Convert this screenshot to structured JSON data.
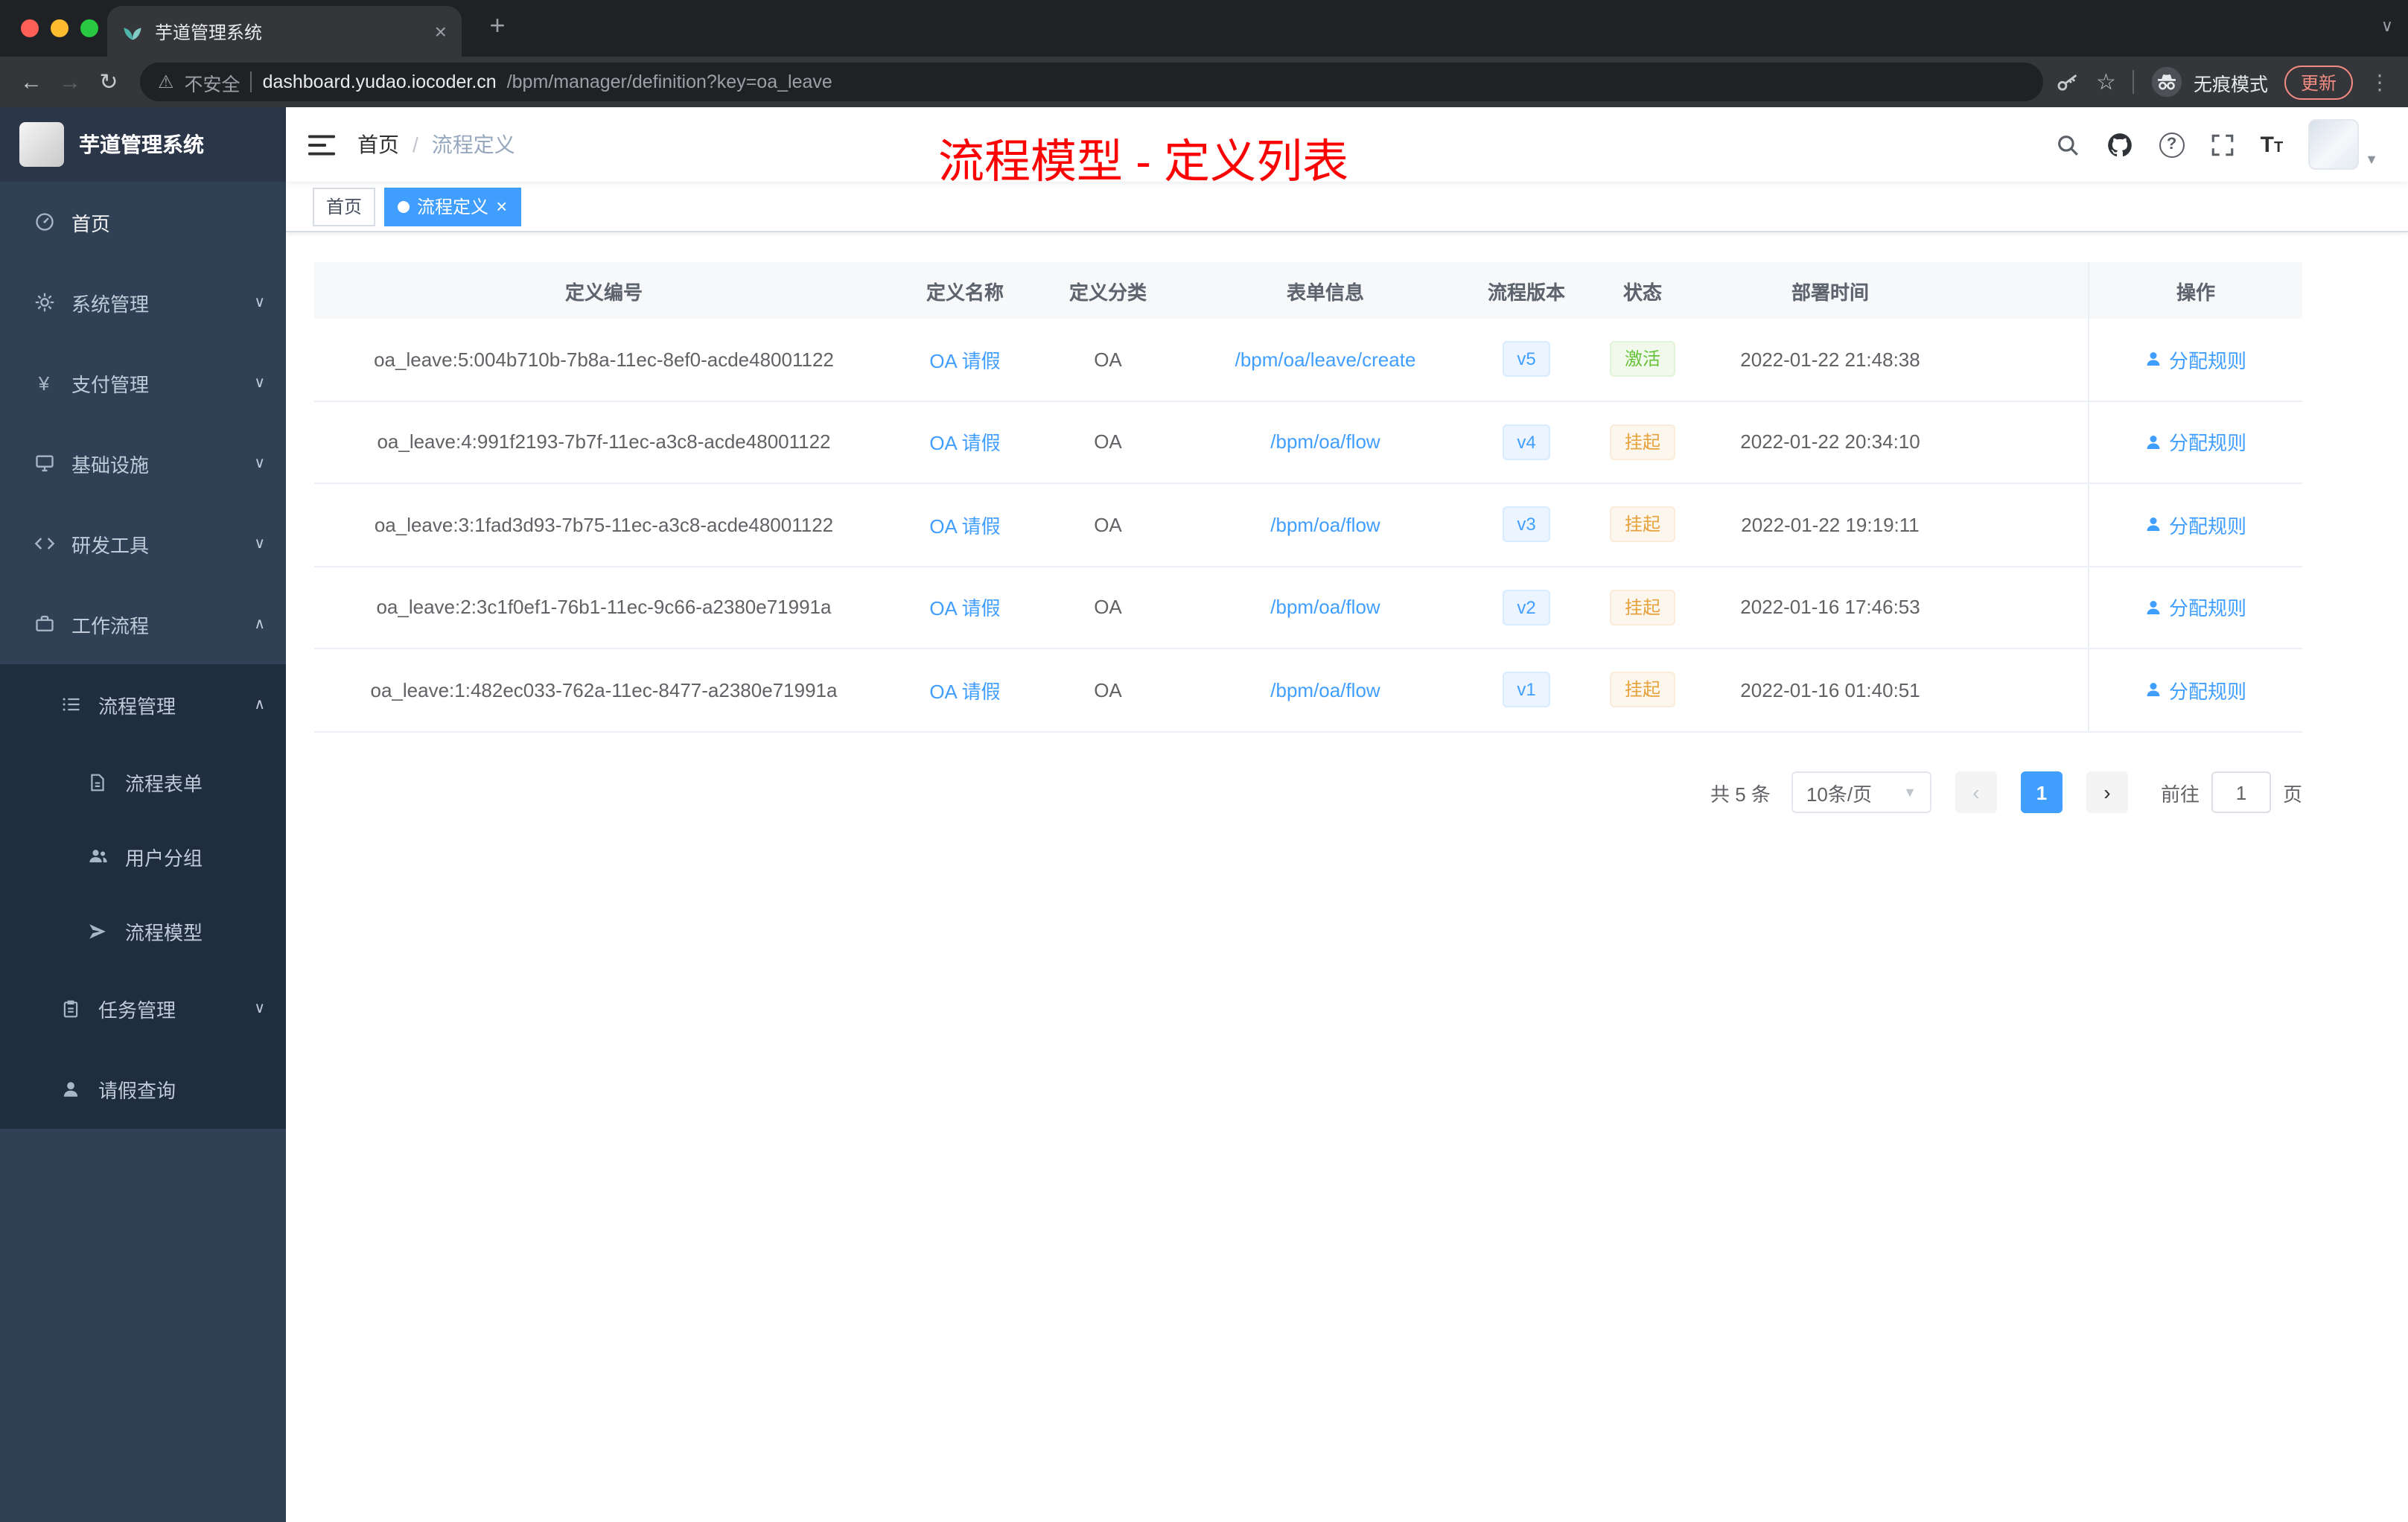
{
  "browser": {
    "tab_title": "芋道管理系统",
    "security_label": "不安全",
    "url_domain": "dashboard.yudao.iocoder.cn",
    "url_path": "/bpm/manager/definition?key=oa_leave",
    "incognito_label": "无痕模式",
    "update_label": "更新"
  },
  "sidebar": {
    "logo_title": "芋道管理系统",
    "items": [
      {
        "label": "首页"
      },
      {
        "label": "系统管理"
      },
      {
        "label": "支付管理"
      },
      {
        "label": "基础设施"
      },
      {
        "label": "研发工具"
      },
      {
        "label": "工作流程"
      },
      {
        "label": "流程管理"
      },
      {
        "label": "流程表单"
      },
      {
        "label": "用户分组"
      },
      {
        "label": "流程模型"
      },
      {
        "label": "任务管理"
      },
      {
        "label": "请假查询"
      }
    ]
  },
  "header": {
    "breadcrumb": {
      "home": "首页",
      "sep": "/",
      "current": "流程定义"
    },
    "annotation": "流程模型 - 定义列表"
  },
  "tags": {
    "home": "首页",
    "active": "流程定义"
  },
  "table": {
    "columns": [
      "定义编号",
      "定义名称",
      "定义分类",
      "表单信息",
      "流程版本",
      "状态",
      "部署时间",
      "操作"
    ],
    "rows": [
      {
        "id": "oa_leave:5:004b710b-7b8a-11ec-8ef0-acde48001122",
        "name": "OA 请假",
        "category": "OA",
        "form": "/bpm/oa/leave/create",
        "version": "v5",
        "status": "激活",
        "status_type": "success",
        "time": "2022-01-22 21:48:38",
        "action": "分配规则"
      },
      {
        "id": "oa_leave:4:991f2193-7b7f-11ec-a3c8-acde48001122",
        "name": "OA 请假",
        "category": "OA",
        "form": "/bpm/oa/flow",
        "version": "v4",
        "status": "挂起",
        "status_type": "warning",
        "time": "2022-01-22 20:34:10",
        "action": "分配规则"
      },
      {
        "id": "oa_leave:3:1fad3d93-7b75-11ec-a3c8-acde48001122",
        "name": "OA 请假",
        "category": "OA",
        "form": "/bpm/oa/flow",
        "version": "v3",
        "status": "挂起",
        "status_type": "warning",
        "time": "2022-01-22 19:19:11",
        "action": "分配规则"
      },
      {
        "id": "oa_leave:2:3c1f0ef1-76b1-11ec-9c66-a2380e71991a",
        "name": "OA 请假",
        "category": "OA",
        "form": "/bpm/oa/flow",
        "version": "v2",
        "status": "挂起",
        "status_type": "warning",
        "time": "2022-01-16 17:46:53",
        "action": "分配规则"
      },
      {
        "id": "oa_leave:1:482ec033-762a-11ec-8477-a2380e71991a",
        "name": "OA 请假",
        "category": "OA",
        "form": "/bpm/oa/flow",
        "version": "v1",
        "status": "挂起",
        "status_type": "warning",
        "time": "2022-01-16 01:40:51",
        "action": "分配规则"
      }
    ]
  },
  "pagination": {
    "total": "共 5 条",
    "page_size": "10条/页",
    "page": "1",
    "goto_label": "前往",
    "goto_value": "1",
    "unit_label": "页"
  },
  "colors": {
    "accent": "#409eff",
    "success": "#67c23a",
    "warning": "#e6a23c",
    "annotation_red": "#fb0303",
    "sidebar_bg": "#304156",
    "submenu_bg": "#1f2d3d"
  }
}
